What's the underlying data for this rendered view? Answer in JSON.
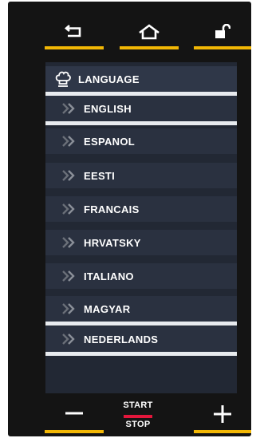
{
  "top_bar": {
    "back_icon": "back-arrow-icon",
    "home_icon": "home-icon",
    "lock_icon": "unlock-icon"
  },
  "menu": {
    "title": "LANGUAGE",
    "title_icon": "chef-hat-icon",
    "items": [
      {
        "label": "ENGLISH"
      },
      {
        "label": "ESPANOL"
      },
      {
        "label": "EESTI"
      },
      {
        "label": "FRANCAIS"
      },
      {
        "label": "HRVATSKY"
      },
      {
        "label": "ITALIANO"
      },
      {
        "label": "MAGYAR"
      },
      {
        "label": "NEDERLANDS"
      }
    ]
  },
  "bottom_bar": {
    "start_label": "START",
    "stop_label": "STOP",
    "minus_icon": "minus-icon",
    "plus_icon": "plus-icon"
  },
  "colors": {
    "accent_yellow": "#f2b705",
    "start_red": "#e2163b",
    "panel_bg": "#141414",
    "row_bg": "#2a3140",
    "divider": "#e8ebef"
  }
}
